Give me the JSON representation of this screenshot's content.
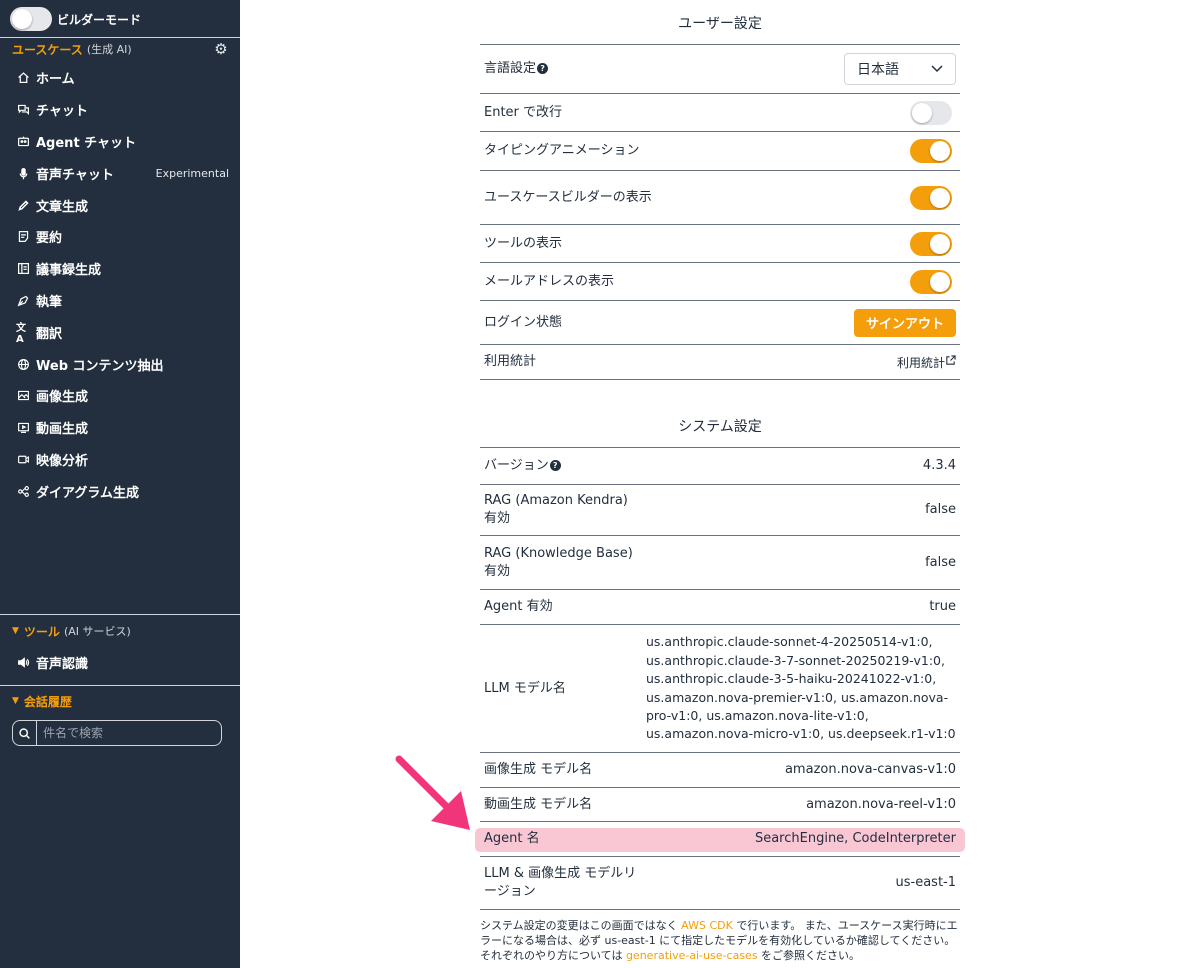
{
  "sidebar": {
    "builder_mode_label": "ビルダーモード",
    "usecase_section": {
      "title": "ユースケース",
      "subtitle": "(生成 AI)"
    },
    "items": [
      {
        "label": "ホーム",
        "icon": "home-icon"
      },
      {
        "label": "チャット",
        "icon": "chat-icon"
      },
      {
        "label": "Agent チャット",
        "icon": "robot-icon"
      },
      {
        "label": "音声チャット",
        "icon": "microphone-icon",
        "badge": "Experimental"
      },
      {
        "label": "文章生成",
        "icon": "pencil-icon"
      },
      {
        "label": "要約",
        "icon": "note-icon"
      },
      {
        "label": "議事録生成",
        "icon": "minutes-icon"
      },
      {
        "label": "執筆",
        "icon": "pen-nib-icon"
      },
      {
        "label": "翻訳",
        "icon": "translate-icon"
      },
      {
        "label": "Web コンテンツ抽出",
        "icon": "globe-icon"
      },
      {
        "label": "画像生成",
        "icon": "image-icon"
      },
      {
        "label": "動画生成",
        "icon": "video-screen-icon"
      },
      {
        "label": "映像分析",
        "icon": "video-camera-icon"
      },
      {
        "label": "ダイアグラム生成",
        "icon": "diagram-icon"
      }
    ],
    "tools_section": {
      "title": "ツール",
      "subtitle": "(AI サービス)"
    },
    "tools": [
      {
        "label": "音声認識",
        "icon": "speaker-icon"
      }
    ],
    "history_section": {
      "title": "会話履歴"
    },
    "search": {
      "placeholder": "件名で検索",
      "value": ""
    }
  },
  "user_settings": {
    "title": "ユーザー設定",
    "language": {
      "label": "言語設定",
      "value": "日本語"
    },
    "enter_newline": {
      "label": "Enter で改行",
      "enabled": false
    },
    "typing_animation": {
      "label": "タイピングアニメーション",
      "enabled": true
    },
    "usecase_builder_visible": {
      "label": "ユースケースビルダーの表示",
      "enabled": true
    },
    "tools_visible": {
      "label": "ツールの表示",
      "enabled": true
    },
    "email_visible": {
      "label": "メールアドレスの表示",
      "enabled": true
    },
    "login_status": {
      "label": "ログイン状態",
      "button": "サインアウト"
    },
    "usage_stats": {
      "label": "利用統計",
      "link": "利用統計"
    }
  },
  "system_settings": {
    "title": "システム設定",
    "version": {
      "label": "バージョン",
      "value": "4.3.4"
    },
    "rag_kendra": {
      "label": "RAG (Amazon Kendra) 有効",
      "value": "false"
    },
    "rag_kb": {
      "label": "RAG (Knowledge Base) 有効",
      "value": "false"
    },
    "agent_enabled": {
      "label": "Agent 有効",
      "value": "true"
    },
    "llm_models": {
      "label": "LLM モデル名",
      "value": "us.anthropic.claude-sonnet-4-20250514-v1:0, us.anthropic.claude-3-7-sonnet-20250219-v1:0, us.anthropic.claude-3-5-haiku-20241022-v1:0, us.amazon.nova-premier-v1:0, us.amazon.nova-pro-v1:0, us.amazon.nova-lite-v1:0, us.amazon.nova-micro-v1:0, us.deepseek.r1-v1:0"
    },
    "image_model": {
      "label": "画像生成 モデル名",
      "value": "amazon.nova-canvas-v1:0"
    },
    "video_model": {
      "label": "動画生成 モデル名",
      "value": "amazon.nova-reel-v1:0"
    },
    "agent_names": {
      "label": "Agent 名",
      "value": "SearchEngine, CodeInterpreter"
    },
    "model_region": {
      "label": "LLM & 画像生成 モデルリージョン",
      "value": "us-east-1"
    },
    "footnote": {
      "part1": "システム設定の変更はこの画面ではなく ",
      "link1": "AWS CDK",
      "part2": " で行います。 また、ユースケース実行時にエラーになる場合は、必ず us-east-1 にて指定したモデルを有効化しているか確認してください。それぞれのやり方については ",
      "link2": "generative-ai-use-cases",
      "part3": " をご参照ください。"
    }
  },
  "colors": {
    "accent": "#f59e0b",
    "sidebar_bg": "#232f3e",
    "highlight": "#f9c6d4",
    "arrow": "#f0357a"
  }
}
